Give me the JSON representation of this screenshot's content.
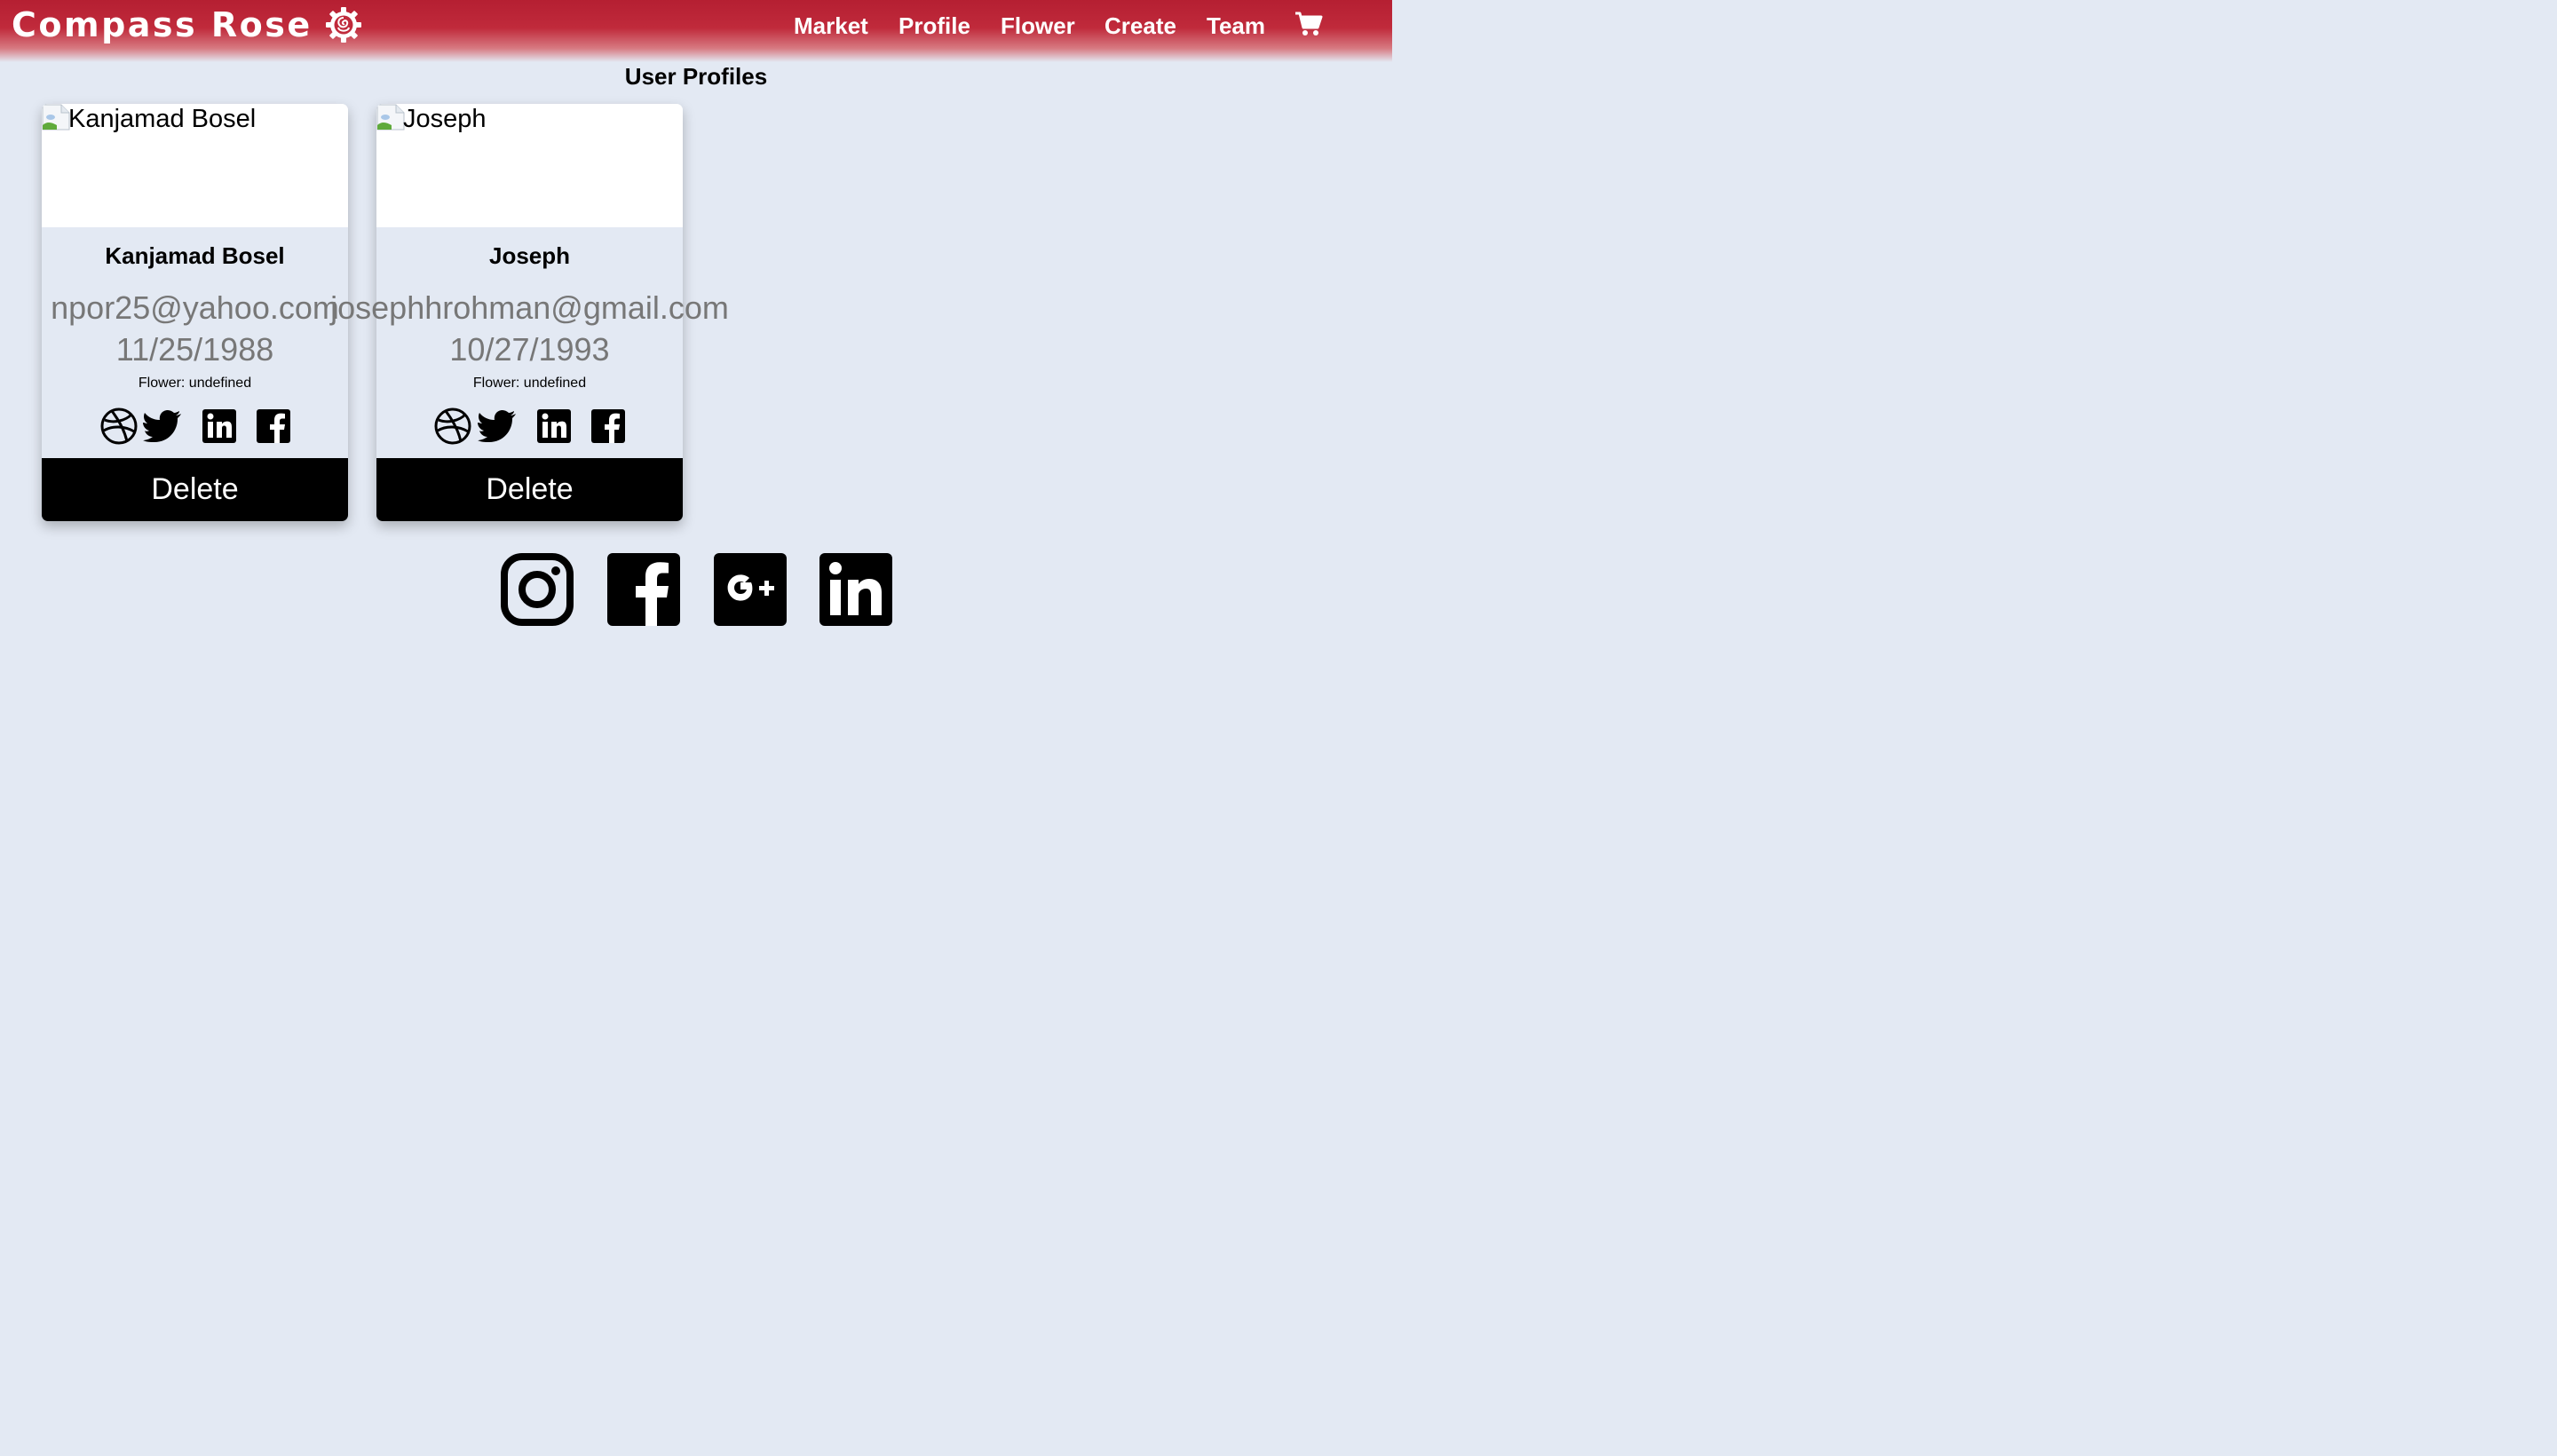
{
  "navbar": {
    "brand": "Compass Rose",
    "logo_icon": "rose-gear-icon",
    "links": [
      "Market",
      "Profile",
      "Flower",
      "Create",
      "Team"
    ],
    "cart_icon": "shopping-cart-icon",
    "colors": {
      "bar": "#b51f32",
      "text": "#ffffff"
    }
  },
  "page": {
    "title": "User Profiles",
    "background": "#e3e9f3"
  },
  "profiles": [
    {
      "image_alt": "Kanjamad Bosel",
      "name": "Kanjamad Bosel",
      "email": "npor25@yahoo.com",
      "dob": "11/25/1988",
      "flower": "Flower: undefined",
      "social_icons": [
        "dribbble-icon",
        "twitter-icon",
        "linkedin-icon",
        "facebook-icon"
      ],
      "delete_label": "Delete"
    },
    {
      "image_alt": "Joseph",
      "name": "Joseph",
      "email": "josephhrohman@gmail.com",
      "dob": "10/27/1993",
      "flower": "Flower: undefined",
      "social_icons": [
        "dribbble-icon",
        "twitter-icon",
        "linkedin-icon",
        "facebook-icon"
      ],
      "delete_label": "Delete"
    }
  ],
  "footer": {
    "social_icons": [
      "instagram-icon",
      "facebook-icon",
      "google-plus-icon",
      "linkedin-icon"
    ]
  }
}
